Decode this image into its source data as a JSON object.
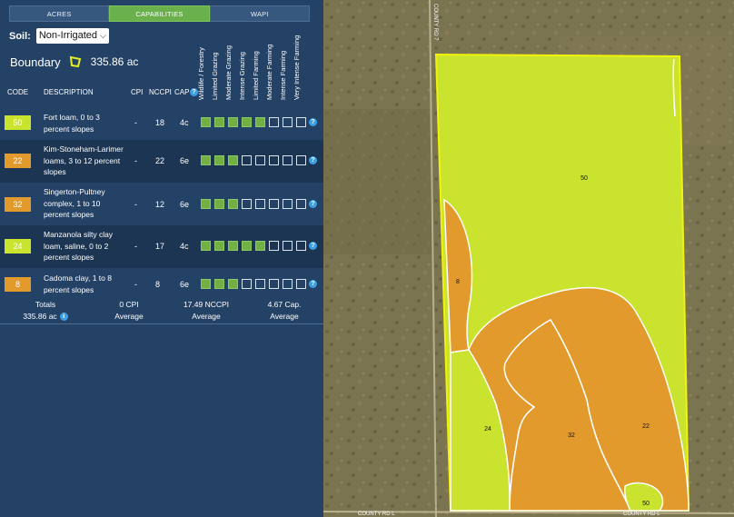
{
  "tabs": [
    {
      "label": "ACRES",
      "active": false
    },
    {
      "label": "CAPABILITIES",
      "active": true
    },
    {
      "label": "WAPI",
      "active": false
    }
  ],
  "soil": {
    "label": "Soil:",
    "selected": "Non-Irrigated"
  },
  "boundary": {
    "label": "Boundary",
    "acres": "335.86 ac"
  },
  "table_headers": {
    "code": "CODE",
    "description": "DESCRIPTION",
    "cpi": "CPI",
    "nccpi": "NCCPI",
    "cap": "CAP"
  },
  "capability_classes": [
    "Wildlife / Forestry",
    "Limited Grazing",
    "Moderate Grazing",
    "Intense Grazing",
    "Limited Farming",
    "Moderate Farming",
    "Intense Farming",
    "Very Intense Farming"
  ],
  "rows": [
    {
      "code": "50",
      "color": "#c9e32e",
      "description": "Fort loam, 0 to 3 percent slopes",
      "cpi": "-",
      "nccpi": "18",
      "cap": "4c",
      "filled": 5
    },
    {
      "code": "22",
      "color": "#e39a2c",
      "description": "Kim-Stoneham-Larimer loams, 3 to 12 percent slopes",
      "cpi": "-",
      "nccpi": "22",
      "cap": "6e",
      "filled": 3
    },
    {
      "code": "32",
      "color": "#e39a2c",
      "description": "Singerton-Pultney complex, 1 to 10 percent slopes",
      "cpi": "-",
      "nccpi": "12",
      "cap": "6e",
      "filled": 3
    },
    {
      "code": "24",
      "color": "#c9e32e",
      "description": "Manzanola silty clay loam, saline, 0 to 2 percent slopes",
      "cpi": "-",
      "nccpi": "17",
      "cap": "4c",
      "filled": 5
    },
    {
      "code": "8",
      "color": "#e39a2c",
      "description": "Cadoma clay, 1 to 8 percent slopes",
      "cpi": "-",
      "nccpi": "8",
      "cap": "6e",
      "filled": 3
    }
  ],
  "totals": {
    "label": "Totals",
    "acres": "335.86 ac",
    "cpi_value": "0 CPI",
    "cpi_sub": "Average",
    "nccpi_value": "17.49 NCCPI",
    "nccpi_sub": "Average",
    "cap_value": "4.67 Cap.",
    "cap_sub": "Average"
  },
  "map": {
    "road_labels": [
      "COUNTY RD 7",
      "COUNTY RD L",
      "COUNTY RD L"
    ],
    "polygon_labels": [
      "50",
      "8",
      "24",
      "32",
      "22",
      "50"
    ],
    "colors": {
      "yellow": "#c9e32e",
      "orange": "#e39a2c",
      "boundary": "#f2f20a"
    }
  },
  "icons": {
    "info": "info-icon",
    "boundary": "polygon-icon",
    "dropdown": "chevron-down-icon"
  }
}
